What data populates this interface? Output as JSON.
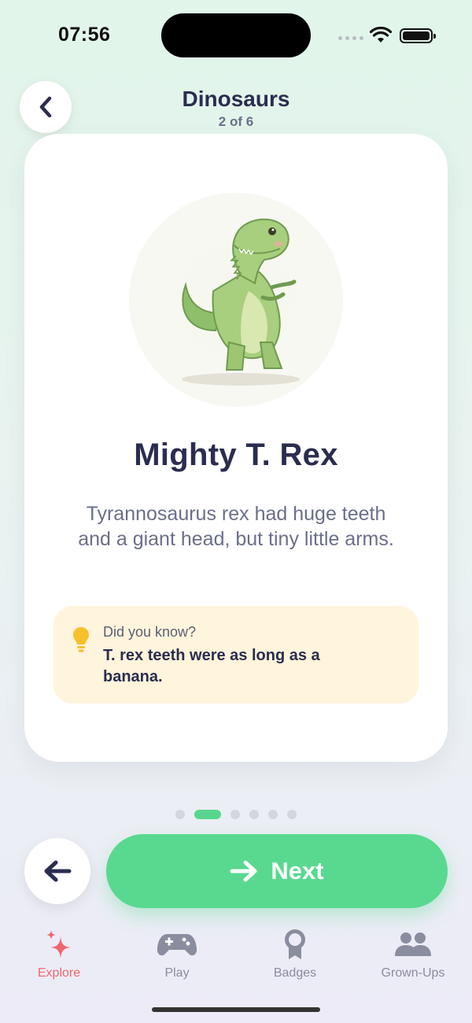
{
  "status": {
    "time": "07:56"
  },
  "header": {
    "title": "Dinosaurs",
    "progress": "2 of 6"
  },
  "card": {
    "title": "Mighty T. Rex",
    "description": "Tyrannosaurus rex had huge teeth and a giant head, but tiny little arms.",
    "fact": {
      "label": "Did you know?",
      "text": "T. rex teeth were as long as a banana."
    }
  },
  "pager": {
    "total": 6,
    "current": 2
  },
  "actions": {
    "next_label": "Next"
  },
  "tabs": [
    {
      "label": "Explore",
      "icon": "sparkles-icon",
      "active": true
    },
    {
      "label": "Play",
      "icon": "gamepad-icon",
      "active": false
    },
    {
      "label": "Badges",
      "icon": "badge-icon",
      "active": false
    },
    {
      "label": "Grown-Ups",
      "icon": "people-icon",
      "active": false
    }
  ],
  "colors": {
    "accent": "#58d98f",
    "active_tab": "#f0666c",
    "fact_bg": "#fff4dc",
    "title": "#2b2d4f"
  }
}
